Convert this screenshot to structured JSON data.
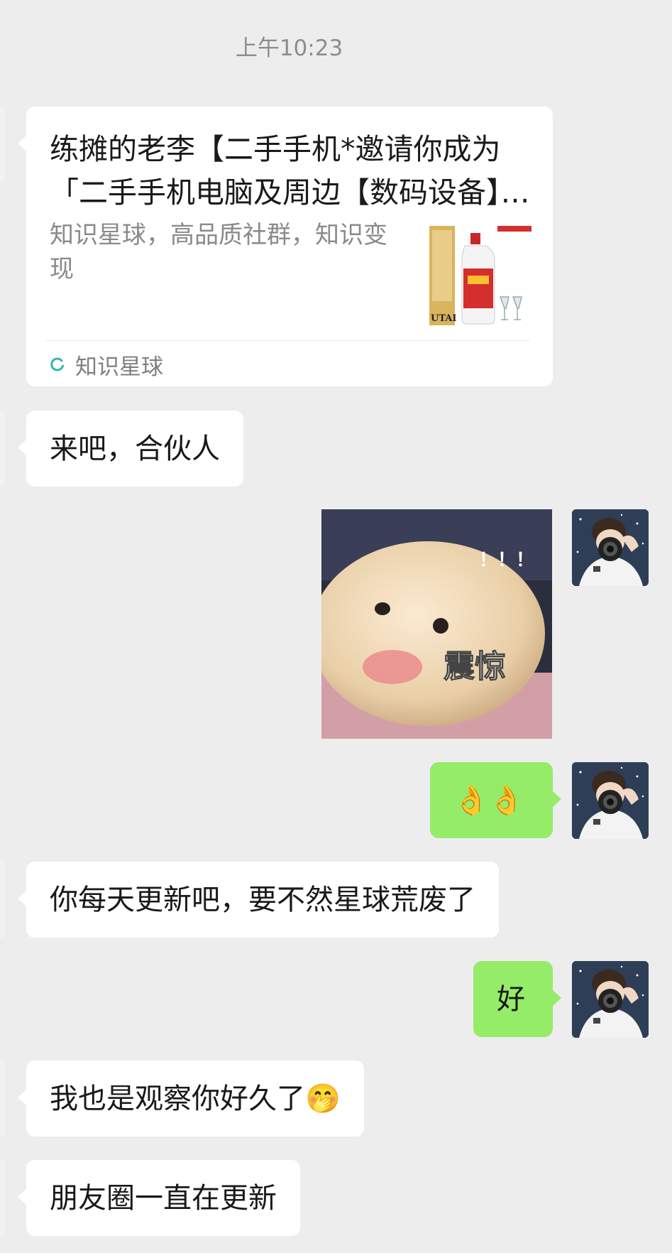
{
  "time_label": "上午10:23",
  "link_card": {
    "title": "练摊的老李【二手手机*邀请你成为「二手手机电脑及周边【数码设备】」成员",
    "description": "知识星球，高品质社群，知识变现",
    "thumbnail_text": "UTAI",
    "source_icon": "knowledge-planet-icon",
    "source_name": "知识星球"
  },
  "messages": [
    {
      "side": "in",
      "text": "来吧，合伙人"
    },
    {
      "side": "out",
      "type": "sticker",
      "caption": "震惊",
      "exclaim": "！！！"
    },
    {
      "side": "out",
      "text": "👌👌"
    },
    {
      "side": "in",
      "text": "你每天更新吧，要不然星球荒废了"
    },
    {
      "side": "out",
      "text": "好"
    },
    {
      "side": "in",
      "text": "我也是观察你好久了🤭"
    },
    {
      "side": "in",
      "text": "朋友圈一直在更新"
    }
  ],
  "colors": {
    "background": "#ededed",
    "incoming_bubble": "#ffffff",
    "outgoing_bubble": "#95ec69",
    "timestamp_text": "#8d8d8d"
  }
}
